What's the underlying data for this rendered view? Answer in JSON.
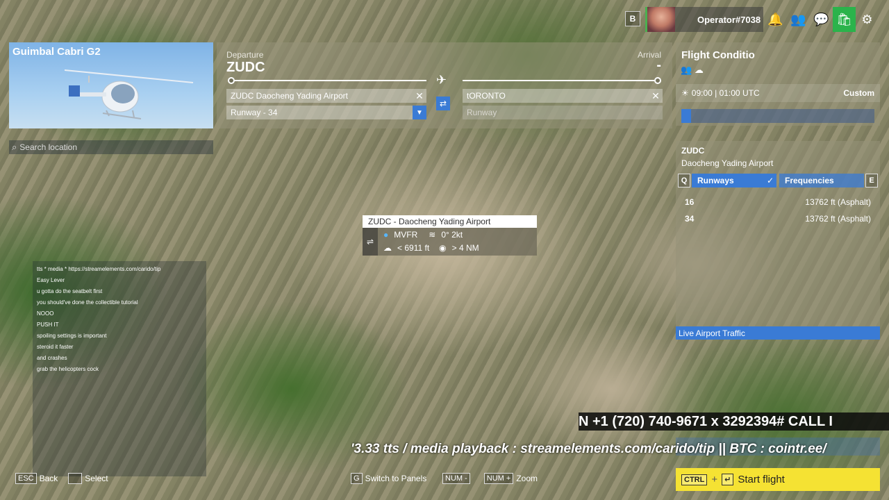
{
  "topbar": {
    "b_key": "B",
    "username": "Operator#7038",
    "icons": [
      "bell-icon",
      "friends-icon",
      "chat-icon",
      "marketplace-icon",
      "settings-icon"
    ]
  },
  "aircraft": {
    "name": "Guimbal Cabri G2"
  },
  "search": {
    "placeholder": "Search location"
  },
  "route": {
    "departure_label": "Departure",
    "departure_code": "ZUDC",
    "arrival_label": "Arrival",
    "arrival_code": "-",
    "departure_airport": "ZUDC Daocheng Yading Airport",
    "departure_runway": "Runway - 34",
    "arrival_airport": "tORONTO",
    "arrival_runway_placeholder": "Runway"
  },
  "conditions": {
    "title": "Flight Conditio",
    "time": "09:00 | 01:00 UTC",
    "preset": "Custom",
    "time_fraction": 0.05
  },
  "airport": {
    "code": "ZUDC",
    "name": "Daocheng Yading Airport",
    "tab_prev_key": "Q",
    "tab_next_key": "E",
    "tabs": [
      "Runways",
      "Frequencies"
    ],
    "runways": [
      {
        "number": "16",
        "length": "13762 ft (Asphalt)"
      },
      {
        "number": "34",
        "length": "13762 ft (Asphalt)"
      }
    ],
    "live_traffic": "Live Airport Traffic"
  },
  "map_tooltip": {
    "title": "ZUDC - Daocheng Yading Airport",
    "category": "MVFR",
    "wind": "0° 2kt",
    "ceiling": "< 6911 ft",
    "visibility": "> 4 NM"
  },
  "chat": [
    {
      "user": "",
      "msg": "tts * media * https://streamelements.com/carido/tip",
      "color": ""
    },
    {
      "user": "",
      "msg": "Easy Lever",
      "color": "u"
    },
    {
      "user": "",
      "msg": "u gotta do the seatbelt first",
      "color": "u red"
    },
    {
      "user": "",
      "msg": "you should've done the collectible tutorial",
      "color": "u"
    },
    {
      "user": "",
      "msg": "NOOO",
      "color": "u green"
    },
    {
      "user": "",
      "msg": "PUSH IT",
      "color": "u"
    },
    {
      "user": "",
      "msg": "spoiling settings is important",
      "color": "u red"
    },
    {
      "user": "",
      "msg": "steroid it faster",
      "color": "u"
    },
    {
      "user": "",
      "msg": "",
      "color": "u"
    },
    {
      "user": "",
      "msg": "",
      "color": "u green"
    },
    {
      "user": "",
      "msg": "and crashes",
      "color": "u green"
    },
    {
      "user": "",
      "msg": "grab the helicopters cock",
      "color": "u green"
    },
    {
      "user": "",
      "msg": "",
      "color": "u"
    },
    {
      "user": "",
      "msg": "",
      "color": "u red"
    }
  ],
  "hints": {
    "back_key": "ESC",
    "back_label": "Back",
    "select_label": "Select",
    "panels_key": "G",
    "panels_label": "Switch to Panels",
    "zoom_out_key": "NUM -",
    "zoom_in_key": "NUM +",
    "zoom_label": "Zoom"
  },
  "overlays": {
    "call_ticker": "N +1 (720) 740-9671 x 3292394#   CALL I",
    "tip_ticker": "'3.33 tts / media playback : streamelements.com/carido/tip || BTC : cointr.ee/"
  },
  "start": {
    "key": "CTRL",
    "plus": "+",
    "label": "Start flight"
  },
  "colors": {
    "accent": "#3a7bd5",
    "start": "#f5e233",
    "online": "#2bb34b"
  }
}
